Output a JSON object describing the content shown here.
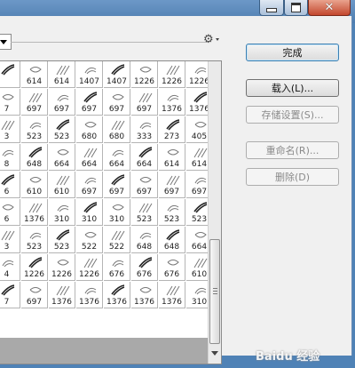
{
  "window": {
    "controls": {
      "minimize_icon": "minimize-icon",
      "maximize_icon": "maximize-icon",
      "close_icon": "close-icon",
      "close_glyph": "✕"
    }
  },
  "toolbar": {
    "gear_glyph": "⚙"
  },
  "presets": {
    "rows": [
      [
        "",
        "614",
        "614",
        "1407",
        "1407",
        "1226",
        "1226",
        "1226"
      ],
      [
        "7",
        "697",
        "697",
        "697",
        "697",
        "697",
        "1376",
        "1376"
      ],
      [
        "3",
        "523",
        "523",
        "680",
        "680",
        "333",
        "273",
        "405"
      ],
      [
        "8",
        "648",
        "664",
        "664",
        "664",
        "664",
        "614",
        "614"
      ],
      [
        "6",
        "610",
        "610",
        "697",
        "697",
        "697",
        "697",
        "697"
      ],
      [
        "6",
        "1376",
        "310",
        "310",
        "310",
        "523",
        "523",
        "523"
      ],
      [
        "3",
        "523",
        "523",
        "522",
        "522",
        "648",
        "648",
        "664"
      ],
      [
        "4",
        "1226",
        "1226",
        "1226",
        "676",
        "676",
        "676",
        "610"
      ],
      [
        "7",
        "697",
        "1376",
        "1376",
        "1376",
        "1376",
        "1376",
        "310"
      ]
    ]
  },
  "buttons": {
    "done": "完成",
    "load": "载入(L)...",
    "save_set": "存储设置(S)...",
    "rename": "重命名(R)...",
    "delete": "删除(D)"
  },
  "watermark": {
    "text": "Baidu 经验"
  }
}
